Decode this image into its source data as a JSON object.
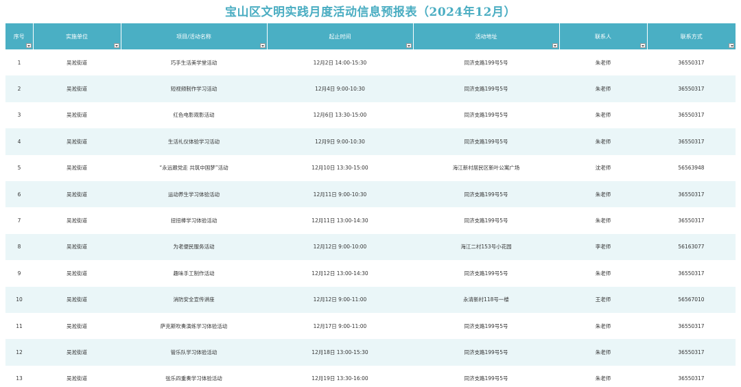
{
  "title": "宝山区文明实践月度活动信息预报表（2024年12月）",
  "headers": [
    "序号",
    "实施单位",
    "项目/活动名称",
    "起止时间",
    "活动地址",
    "联系人",
    "联系方式"
  ],
  "rows": [
    [
      "1",
      "吴淞街道",
      "巧手生活美学堂活动",
      "12月2日 14:00-15:30",
      "同济支路199号5号",
      "朱老师",
      "36550317"
    ],
    [
      "2",
      "吴淞街道",
      "短视频制作学习活动",
      "12月4日 9:00-10:30",
      "同济支路199号5号",
      "朱老师",
      "36550317"
    ],
    [
      "3",
      "吴淞街道",
      "红色电影观影活动",
      "12月6日 13:30-15:00",
      "同济支路199号5号",
      "朱老师",
      "36550317"
    ],
    [
      "4",
      "吴淞街道",
      "生活礼仪体验学习活动",
      "12月9日 9:00-10:30",
      "同济支路199号5号",
      "朱老师",
      "36550317"
    ],
    [
      "5",
      "吴淞街道",
      "“永远跟党走 共筑中国梦”活动",
      "12月10日 13:30-15:00",
      "海江新村居民区新叶公寓广场",
      "沈老师",
      "56563948"
    ],
    [
      "6",
      "吴淞街道",
      "运动养生学习体验活动",
      "12月11日 9:00-10:30",
      "同济支路199号5号",
      "朱老师",
      "36550317"
    ],
    [
      "7",
      "吴淞街道",
      "扭扭棒学习体验活动",
      "12月11日 13:00-14:30",
      "同济支路199号5号",
      "朱老师",
      "36550317"
    ],
    [
      "8",
      "吴淞街道",
      "为老便民服务活动",
      "12月12日 9:00-10:00",
      "海江二村153号小花园",
      "李老师",
      "56163077"
    ],
    [
      "9",
      "吴淞街道",
      "趣味手工制作活动",
      "12月12日 13:00-14:30",
      "同济支路199号5号",
      "朱老师",
      "36550317"
    ],
    [
      "10",
      "吴淞街道",
      "消防安全宣传讲座",
      "12月12日 9:00-11:00",
      "永清新村118号一楼",
      "王老师",
      "56567010"
    ],
    [
      "11",
      "吴淞街道",
      "萨克斯吹奏演练学习体验活动",
      "12月17日 9:00-11:00",
      "同济支路199号5号",
      "朱老师",
      "36550317"
    ],
    [
      "12",
      "吴淞街道",
      "管乐队学习体验活动",
      "12月18日 13:00-15:30",
      "同济支路199号5号",
      "朱老师",
      "36550317"
    ],
    [
      "13",
      "吴淞街道",
      "弦乐四重奏学习体验活动",
      "12月19日 13:30-16:00",
      "同济支路199号5号",
      "朱老师",
      "36550317"
    ]
  ],
  "colors": {
    "title": "#4aadc2",
    "header_bg": "#4aafc4",
    "row_alt_bg": "#eaf6f8",
    "row_bg": "#ffffff"
  }
}
